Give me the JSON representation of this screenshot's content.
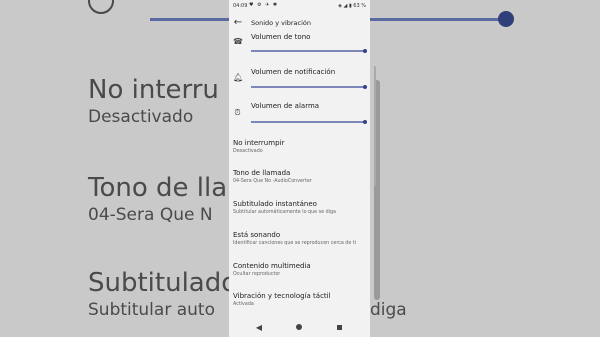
{
  "status_bar": {
    "time": "04:09",
    "icons_left": "♥ ⚙ ✈ ✱",
    "right_text": "◈ ◢ ▮ 63 %"
  },
  "app_bar": {
    "title": "Sonido y vibración",
    "back_icon": "arrow-back-icon"
  },
  "volumes": [
    {
      "label": "Volumen de tono",
      "icon": "ringtone-volume-icon",
      "level": 1.0
    },
    {
      "label": "Volumen de notificación",
      "icon": "bell-icon",
      "level": 1.0
    },
    {
      "label": "Volumen de alarma",
      "icon": "alarm-clock-icon",
      "level": 1.0
    }
  ],
  "settings": [
    {
      "title": "No interrumpir",
      "subtitle": "Desactivado"
    },
    {
      "title": "Tono de llamada",
      "subtitle": "04-Sera Que No -AudioConverter"
    },
    {
      "title": "Subtitulado instantáneo",
      "subtitle": "Subtitular automáticamente lo que se diga"
    },
    {
      "title": "Está sonando",
      "subtitle": "Identificar canciones que se reproducen cerca de ti"
    },
    {
      "title": "Contenido multimedia",
      "subtitle": "Ocultar reproductor"
    },
    {
      "title": "Vibración y tecnología táctil",
      "subtitle": "Activada"
    }
  ],
  "background": {
    "left_big1": "No interru",
    "left_sub1": "Desactivado",
    "left_big2": "Tono de lla",
    "left_sub2": "04-Sera Que N",
    "left_big3": "Subtitulado",
    "left_sub3": "Subtitular auto",
    "right_sub": "diga"
  },
  "nav_bar": {
    "back": "◀",
    "home": "home-icon",
    "recents": "recents-icon"
  },
  "colors": {
    "accent": "#33418a",
    "track": "#7d88b8",
    "background": "#f2f2f2"
  }
}
